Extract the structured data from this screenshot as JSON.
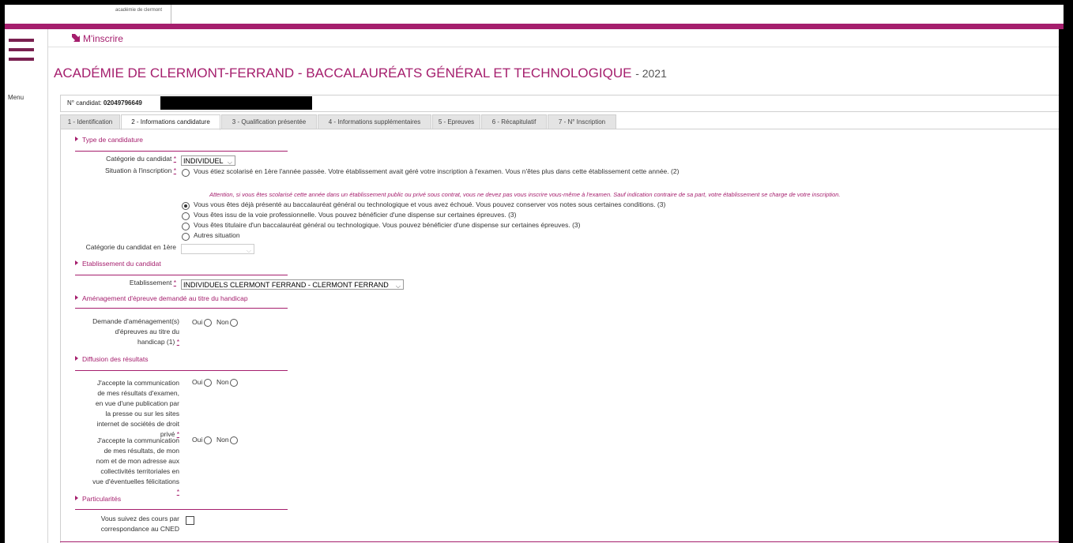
{
  "header": {
    "logo_small_text": "académie de clermont"
  },
  "menu": {
    "label": "Menu"
  },
  "breadcrumb": {
    "label": "M'inscrire"
  },
  "page": {
    "title": "ACADÉMIE DE CLERMONT-FERRAND - BACCALAURÉATS GÉNÉRAL ET TECHNOLOGIQUE",
    "year": "- 2021"
  },
  "candidate": {
    "label": "N° candidat:",
    "number": "02049796649"
  },
  "tabs": [
    {
      "label": "1 - Identification"
    },
    {
      "label": "2 - Informations candidature"
    },
    {
      "label": "3 - Qualification présentée"
    },
    {
      "label": "4 - Informations supplémentaires"
    },
    {
      "label": "5 - Epreuves"
    },
    {
      "label": "6 - Récapitulatif"
    },
    {
      "label": "7 - N° Inscription"
    }
  ],
  "active_tab": 2,
  "required_mark": "*",
  "sections": {
    "type": {
      "title": "Type de candidature",
      "category_label": "Catégorie du candidat",
      "category_value": "INDIVIDUEL",
      "situation_label": "Situation à l'inscription",
      "option_scolarise": "Vous étiez scolarisé en 1ère l'année passée. Votre établissement avait géré votre inscription à l'examen. Vous n'êtes plus dans cette établissement cette année. (2)",
      "warning": "Attention, si vous êtes scolarisé cette année dans un établissement public ou privé sous contrat, vous ne devez pas vous inscrire vous-même à l'examen. Sauf indication contraire de sa part, votre établissement se charge de votre inscription.",
      "options": [
        "Vous vous êtes déjà présenté au baccalauréat général ou technologique et vous avez échoué. Vous pouvez conserver vos notes sous certaines conditions. (3)",
        "Vous êtes issu de la voie professionnelle. Vous pouvez bénéficier d'une dispense sur certaines épreuves. (3)",
        "Vous êtes titulaire d'un baccalauréat général ou technologique. Vous pouvez bénéficier d'une dispense sur certaines épreuves. (3)",
        "Autres situation"
      ],
      "selected_option": 0,
      "category_1ere_label": "Catégorie du candidat en 1ère",
      "category_1ere_value": ""
    },
    "etablissement": {
      "title": "Etablissement du candidat",
      "label": "Etablissement",
      "value": "INDIVIDUELS CLERMONT FERRAND - CLERMONT FERRAND"
    },
    "handicap": {
      "title": "Aménagement d'épreuve demandé au titre du handicap",
      "label": "Demande d'aménagement(s) d'épreuves au titre du handicap (1)"
    },
    "diffusion": {
      "title": "Diffusion des résultats",
      "q1_label": "J'accepte la communication de mes résultats d'examen, en vue d'une publication par la presse ou sur les sites internet de sociétés de droit privé",
      "q2_label": "J'accepte la communication de mes résultats, de mon nom et de mon adresse aux collectivités territoriales en vue d'éventuelles félicitations"
    },
    "particularites": {
      "title": "Particularités",
      "cned_label": "Vous suivez des cours par correspondance au CNED"
    }
  },
  "yes_label": "Oui",
  "no_label": "Non",
  "colors": {
    "accent": "#a51e6d",
    "menu_icon": "#7a2050"
  }
}
